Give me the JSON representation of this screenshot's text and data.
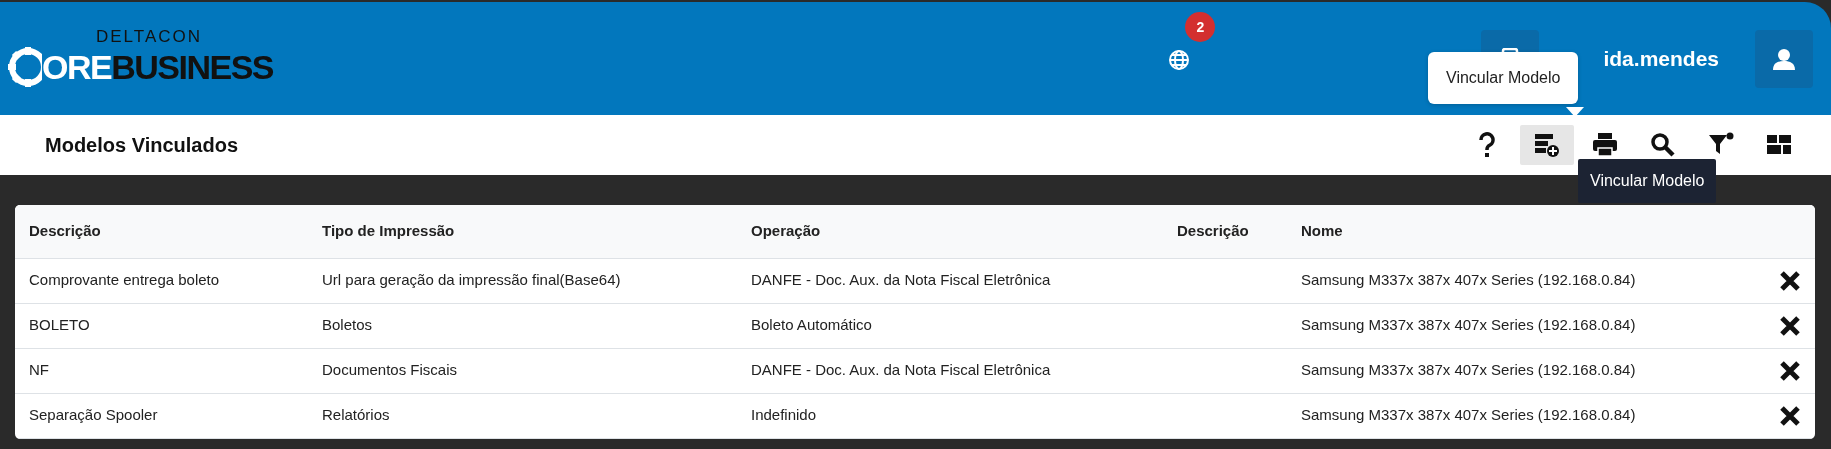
{
  "header": {
    "logo": {
      "top": "DELTACON",
      "left": "ORE",
      "right": "BUSINESS"
    },
    "notifications": {
      "count": "2"
    },
    "user": {
      "name": "ida.mendes"
    }
  },
  "tooltip_popover": "Vincular Modelo",
  "toolbar": {
    "title": "Modelos Vinculados",
    "buttons": [
      {
        "kind": "help",
        "selected": false
      },
      {
        "kind": "link-model",
        "selected": true
      },
      {
        "kind": "print",
        "selected": false
      },
      {
        "kind": "search",
        "selected": false
      },
      {
        "kind": "filter",
        "selected": false
      },
      {
        "kind": "layout",
        "selected": false
      }
    ],
    "tooltip": "Vincular Modelo"
  },
  "table": {
    "columns": [
      "Descrição",
      "Tipo de Impressão",
      "Operação",
      "Descrição",
      "Nome"
    ],
    "rows": [
      {
        "cells": [
          "Comprovante entrega boleto",
          "Url para geração da impressão final(Base64)",
          "DANFE - Doc. Aux. da Nota Fiscal Eletrônica",
          "",
          "Samsung M337x 387x 407x Series (192.168.0.84)"
        ]
      },
      {
        "cells": [
          "BOLETO",
          "Boletos",
          "Boleto Automático",
          "",
          "Samsung M337x 387x 407x Series (192.168.0.84)"
        ]
      },
      {
        "cells": [
          "NF",
          "Documentos Fiscais",
          "DANFE - Doc. Aux. da Nota Fiscal Eletrônica",
          "",
          "Samsung M337x 387x 407x Series (192.168.0.84)"
        ]
      },
      {
        "cells": [
          "Separação Spooler",
          "Relatórios",
          "Indefinido",
          "",
          "Samsung M337x 387x 407x Series (192.168.0.84)"
        ]
      }
    ]
  }
}
